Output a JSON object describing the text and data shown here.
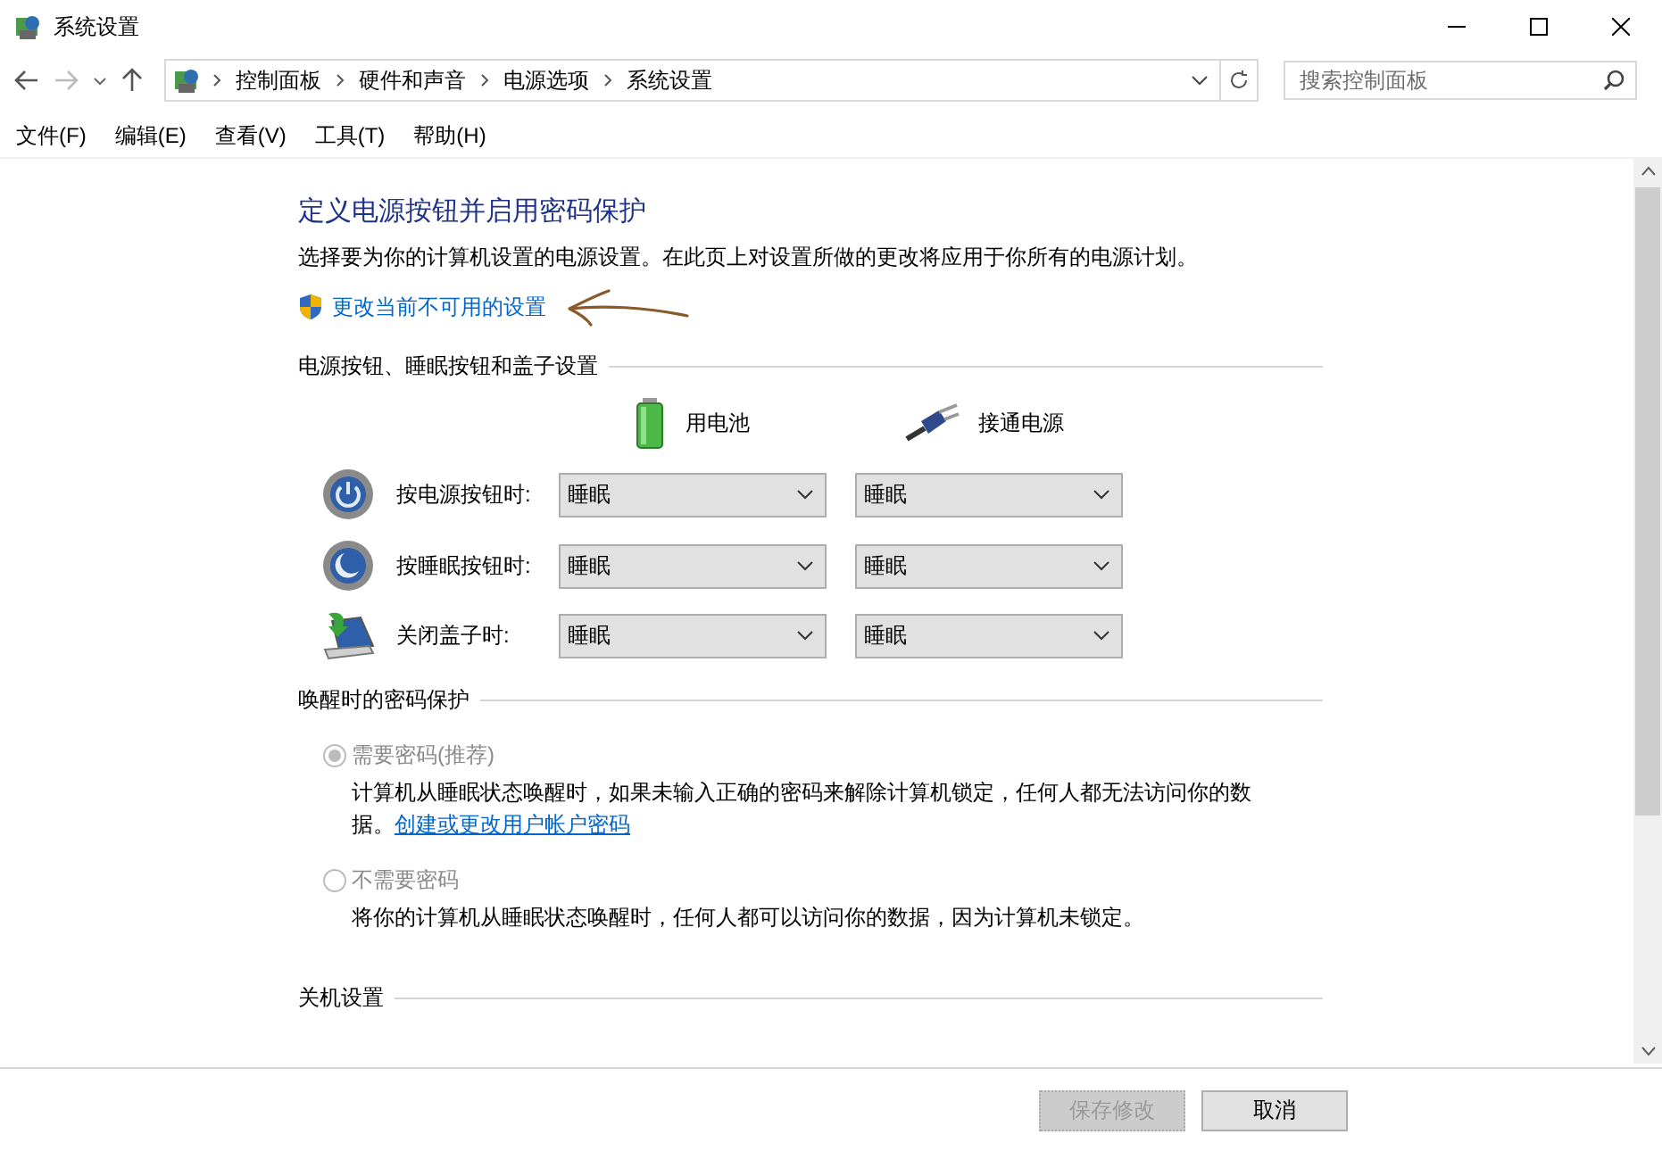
{
  "window": {
    "title": "系统设置"
  },
  "nav": {
    "breadcrumb": [
      "控制面板",
      "硬件和声音",
      "电源选项",
      "系统设置"
    ],
    "search": {
      "placeholder": "搜索控制面板"
    }
  },
  "menu": [
    "文件(F)",
    "编辑(E)",
    "查看(V)",
    "工具(T)",
    "帮助(H)"
  ],
  "page": {
    "title": "定义电源按钮并启用密码保护",
    "description": "选择要为你的计算机设置的电源设置。在此页上对设置所做的更改将应用于你所有的电源计划。",
    "admin_link": "更改当前不可用的设置",
    "buttons_section": {
      "title": "电源按钮、睡眠按钮和盖子设置",
      "columns": [
        {
          "label": "用电池",
          "kind": "battery"
        },
        {
          "label": "接通电源",
          "kind": "plug"
        }
      ],
      "rows": [
        {
          "label": "按电源按钮时:",
          "kind": "power",
          "values": [
            "睡眠",
            "睡眠"
          ]
        },
        {
          "label": "按睡眠按钮时:",
          "kind": "sleep",
          "values": [
            "睡眠",
            "睡眠"
          ]
        },
        {
          "label": "关闭盖子时:",
          "kind": "lid",
          "values": [
            "睡眠",
            "睡眠"
          ]
        }
      ]
    },
    "password_section": {
      "title": "唤醒时的密码保护",
      "options": [
        {
          "label": "需要密码(推荐)",
          "selected": true,
          "disabled": true,
          "description": "计算机从睡眠状态唤醒时，如果未输入正确的密码来解除计算机锁定，任何人都无法访问你的数据。",
          "link": "创建或更改用户帐户密码"
        },
        {
          "label": "不需要密码",
          "selected": false,
          "disabled": true,
          "description": "将你的计算机从睡眠状态唤醒时，任何人都可以访问你的数据，因为计算机未锁定。"
        }
      ]
    },
    "shutdown_section": {
      "title": "关机设置"
    }
  },
  "footer": {
    "buttons": [
      {
        "label": "保存修改",
        "disabled": true
      },
      {
        "label": "取消",
        "disabled": false
      }
    ]
  }
}
